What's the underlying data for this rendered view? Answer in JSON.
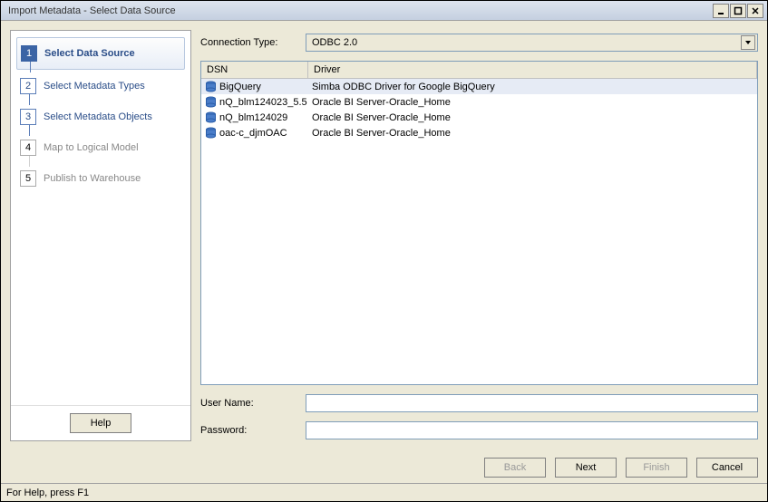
{
  "window": {
    "title": "Import Metadata - Select Data Source"
  },
  "sidebar": {
    "steps": [
      {
        "num": "1",
        "label": "Select Data Source",
        "state": "active"
      },
      {
        "num": "2",
        "label": "Select Metadata Types",
        "state": "done"
      },
      {
        "num": "3",
        "label": "Select Metadata Objects",
        "state": "done"
      },
      {
        "num": "4",
        "label": "Map to Logical Model",
        "state": "future"
      },
      {
        "num": "5",
        "label": "Publish to Warehouse",
        "state": "future"
      }
    ],
    "help_label": "Help"
  },
  "main": {
    "connection_type_label": "Connection Type:",
    "connection_type_value": "ODBC 2.0",
    "columns": {
      "dsn": "DSN",
      "driver": "Driver"
    },
    "data_sources": [
      {
        "dsn": "BigQuery",
        "driver": "Simba ODBC Driver for Google BigQuery",
        "selected": true
      },
      {
        "dsn": "nQ_blm124023_5.5",
        "driver": "Oracle BI Server-Oracle_Home",
        "selected": false
      },
      {
        "dsn": "nQ_blm124029",
        "driver": "Oracle BI Server-Oracle_Home",
        "selected": false
      },
      {
        "dsn": "oac-c_djmOAC",
        "driver": "Oracle BI Server-Oracle_Home",
        "selected": false
      }
    ],
    "username_label": "User Name:",
    "username_value": "",
    "password_label": "Password:",
    "password_value": ""
  },
  "footer": {
    "back": "Back",
    "next": "Next",
    "finish": "Finish",
    "cancel": "Cancel"
  },
  "statusbar": {
    "text": "For Help, press F1"
  }
}
